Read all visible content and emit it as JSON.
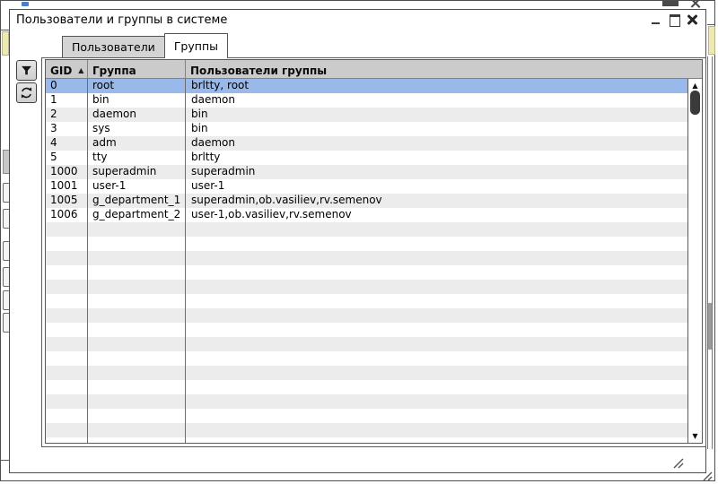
{
  "window": {
    "title": "Пользователи и группы в системе"
  },
  "tabs": [
    {
      "label": "Пользователи",
      "active": false
    },
    {
      "label": "Группы",
      "active": true
    }
  ],
  "toolbar": {
    "buttons": [
      {
        "icon": "filter-funnel"
      },
      {
        "icon": "refresh-arrows"
      }
    ]
  },
  "table": {
    "columns": [
      {
        "label": "GID",
        "sorted": "asc"
      },
      {
        "label": "Группа"
      },
      {
        "label": "Пользователи группы"
      }
    ],
    "sort_indicator": "▲",
    "selected_gid": "0",
    "rows": [
      {
        "gid": "0",
        "group": "root",
        "users": "brltty, root"
      },
      {
        "gid": "1",
        "group": "bin",
        "users": "daemon"
      },
      {
        "gid": "2",
        "group": "daemon",
        "users": "bin"
      },
      {
        "gid": "3",
        "group": "sys",
        "users": "bin"
      },
      {
        "gid": "4",
        "group": "adm",
        "users": "daemon"
      },
      {
        "gid": "5",
        "group": "tty",
        "users": "brltty"
      },
      {
        "gid": "1000",
        "group": "superadmin",
        "users": "superadmin"
      },
      {
        "gid": "1001",
        "group": "user-1",
        "users": "user-1"
      },
      {
        "gid": "1005",
        "group": "g_department_1",
        "users": "superadmin,ob.vasiliev,rv.semenov"
      },
      {
        "gid": "1006",
        "group": "g_department_2",
        "users": "user-1,ob.vasiliev,rv.semenov"
      }
    ],
    "filler_row_count": 16
  },
  "scrollbar": {
    "up_glyph": "▲",
    "down_glyph": "▼"
  },
  "colors": {
    "selection": "#98b9ea",
    "alt_row": "#ececec",
    "header_bg": "#cbcbcb",
    "tab_inactive": "#d4d4d4",
    "paleyellow": "#eee9b2"
  }
}
